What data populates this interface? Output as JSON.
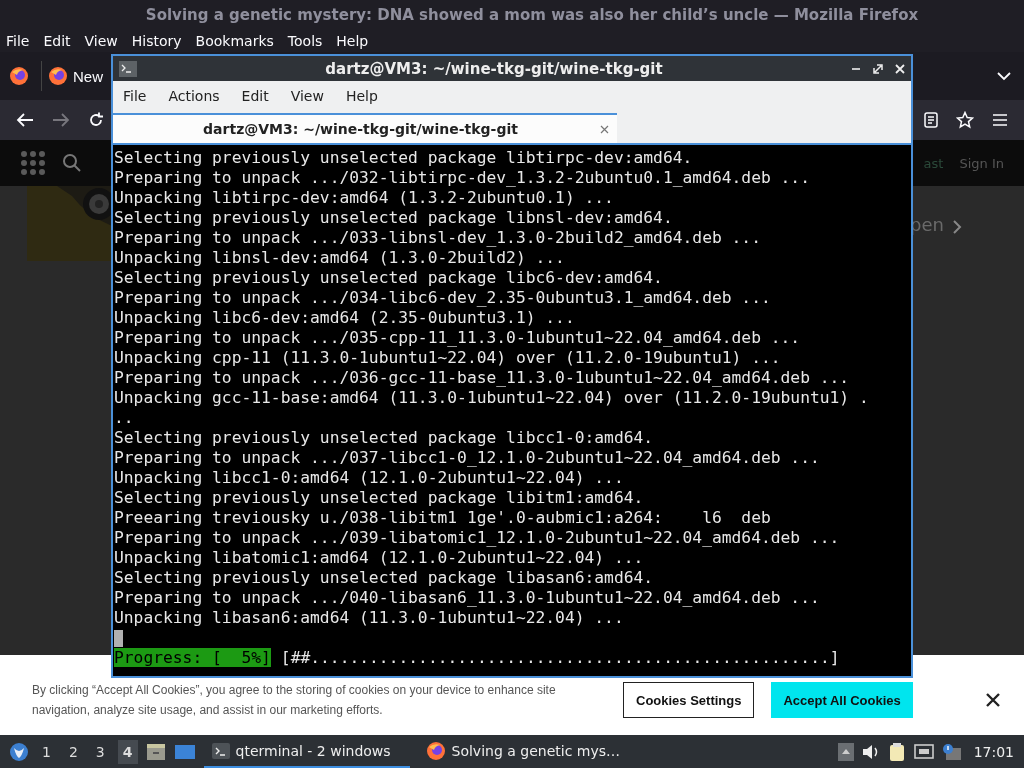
{
  "browser": {
    "title": "Solving a genetic mystery: DNA showed a mom was also her child’s uncle — Mozilla Firefox",
    "menu": [
      "File",
      "Edit",
      "View",
      "History",
      "Bookmarks",
      "Tools",
      "Help"
    ],
    "tab": {
      "label": "New"
    },
    "page": {
      "header_links": [
        "ast",
        "Sign In"
      ],
      "teaser_link": "pen"
    },
    "cookie_banner": {
      "text": "By clicking “Accept All Cookies”, you agree to the storing of cookies on your device to enhance site navigation, analyze site usage, and assist in our marketing efforts.",
      "buttons": [
        {
          "label": "Cookies Settings",
          "kind": "secondary"
        },
        {
          "label": "Accept All Cookies",
          "kind": "primary"
        }
      ]
    }
  },
  "terminal": {
    "title": "dartz@VM3: ~/wine-tkg-git/wine-tkg-git",
    "menu": [
      "File",
      "Actions",
      "Edit",
      "View",
      "Help"
    ],
    "tabs": [
      {
        "label": "dartz@VM3: ~/wine-tkg-git/wine-tkg-git",
        "selected": true
      }
    ],
    "lines": [
      "Selecting previously unselected package libtirpc-dev:amd64.",
      "Preparing to unpack .../032-libtirpc-dev_1.3.2-2ubuntu0.1_amd64.deb ...",
      "Unpacking libtirpc-dev:amd64 (1.3.2-2ubuntu0.1) ...",
      "Selecting previously unselected package libnsl-dev:amd64.",
      "Preparing to unpack .../033-libnsl-dev_1.3.0-2build2_amd64.deb ...",
      "Unpacking libnsl-dev:amd64 (1.3.0-2build2) ...",
      "Selecting previously unselected package libc6-dev:amd64.",
      "Preparing to unpack .../034-libc6-dev_2.35-0ubuntu3.1_amd64.deb ...",
      "Unpacking libc6-dev:amd64 (2.35-0ubuntu3.1) ...",
      "Preparing to unpack .../035-cpp-11_11.3.0-1ubuntu1~22.04_amd64.deb ...",
      "Unpacking cpp-11 (11.3.0-1ubuntu1~22.04) over (11.2.0-19ubuntu1) ...",
      "Preparing to unpack .../036-gcc-11-base_11.3.0-1ubuntu1~22.04_amd64.deb ...",
      "Unpacking gcc-11-base:amd64 (11.3.0-1ubuntu1~22.04) over (11.2.0-19ubuntu1) .",
      "..",
      "Selecting previously unselected package libcc1-0:amd64.",
      "Preparing to unpack .../037-libcc1-0_12.1.0-2ubuntu1~22.04_amd64.deb ...",
      "Unpacking libcc1-0:amd64 (12.1.0-2ubuntu1~22.04) ...",
      "Selecting previously unselected package libitm1:amd64.",
      "Preearing treviousky u./038-libitm1 1ge'.0-aubmic1:a264:    l6  deb",
      "Preparing to unpack .../039-libatomic1_12.1.0-2ubuntu1~22.04_amd64.deb ...",
      "Unpacking libatomic1:amd64 (12.1.0-2ubuntu1~22.04) ...",
      "Selecting previously unselected package libasan6:amd64.",
      "Preparing to unpack .../040-libasan6_11.3.0-1ubuntu1~22.04_amd64.deb ...",
      "Unpacking libasan6:amd64 (11.3.0-1ubuntu1~22.04) ..."
    ],
    "progress": {
      "label": "Progress: [  5%]",
      "bar": "[##.....................................................]"
    }
  },
  "taskbar": {
    "workspaces": [
      {
        "label": "1",
        "selected": false
      },
      {
        "label": "2",
        "selected": false
      },
      {
        "label": "3",
        "selected": false
      },
      {
        "label": "4",
        "selected": true
      }
    ],
    "tasks": [
      {
        "label": "qterminal - 2 windows",
        "selected": true,
        "kind": "terminal"
      },
      {
        "label": "Solving a genetic mys…",
        "selected": false,
        "kind": "firefox"
      }
    ],
    "clock": "17:01"
  }
}
